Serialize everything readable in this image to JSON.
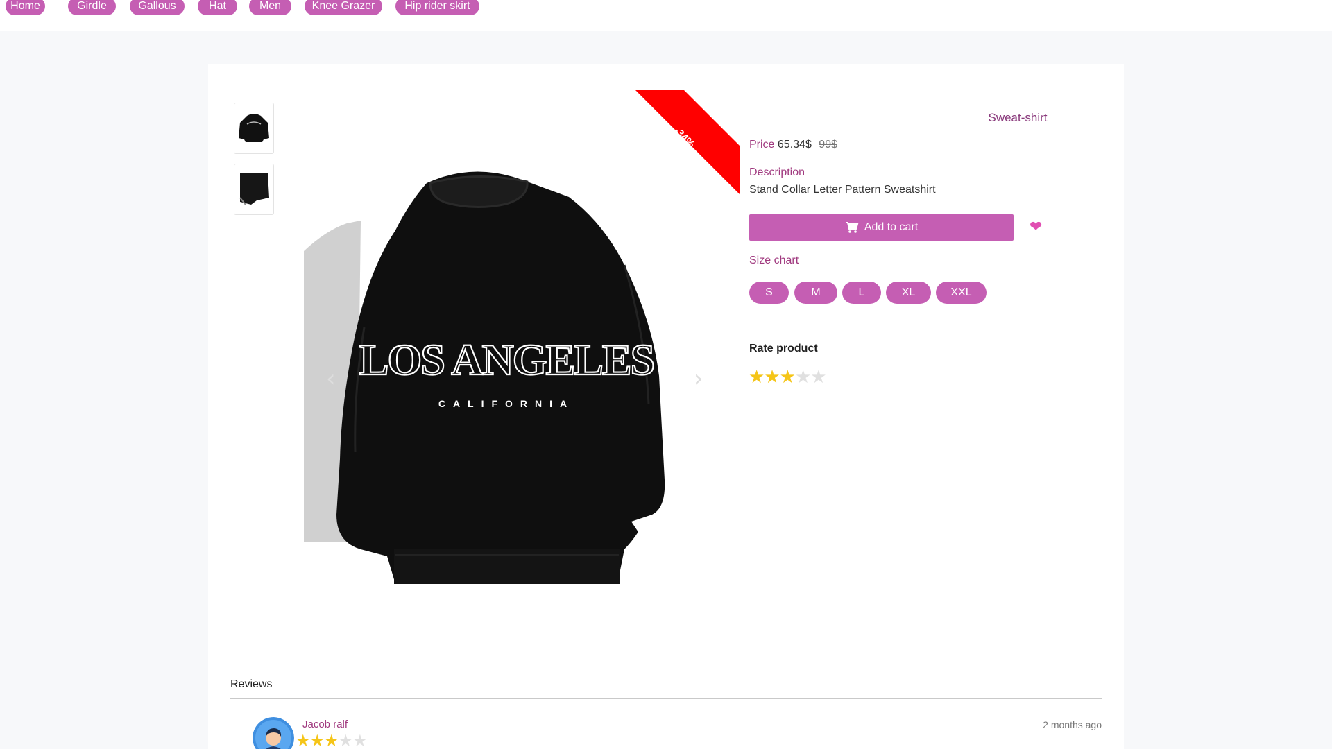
{
  "nav": {
    "items": [
      {
        "label": "Home"
      },
      {
        "label": "Girdle"
      },
      {
        "label": "Gallous"
      },
      {
        "label": "Hat"
      },
      {
        "label": "Men"
      },
      {
        "label": "Knee Grazer"
      },
      {
        "label": "Hip rider skirt"
      }
    ]
  },
  "product": {
    "title": "Sweat-shirt",
    "price_label": "Price",
    "price": "65.34$",
    "old_price": "99$",
    "description_label": "Description",
    "description": "Stand Collar Letter Pattern Sweatshirt",
    "discount_badge": "-34%",
    "add_to_cart_label": "Add to cart",
    "size_chart_label": "Size chart",
    "sizes": [
      "S",
      "M",
      "L",
      "XL",
      "XXL"
    ],
    "rate_label": "Rate product",
    "rating": 3,
    "rating_max": 5,
    "image_graphic_text": {
      "line1": "LOS ANGELES",
      "line2": "CALIFORNIA"
    }
  },
  "reviews": {
    "title": "Reviews",
    "items": [
      {
        "name": "Jacob ralf",
        "rating": 3,
        "rating_max": 5,
        "time": "2 months ago"
      }
    ]
  },
  "colors": {
    "accent": "#c55eb3",
    "accent_text": "#a0397f",
    "badge": "#ff0000",
    "star": "#f5c518",
    "heart": "#e14fb2"
  }
}
